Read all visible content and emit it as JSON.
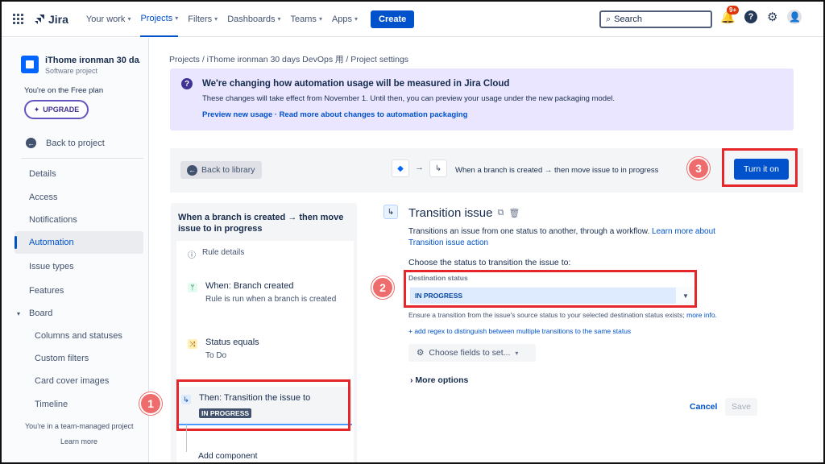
{
  "nav": {
    "logo": "Jira",
    "items": [
      "Your work",
      "Projects",
      "Filters",
      "Dashboards",
      "Teams",
      "Apps"
    ],
    "create": "Create",
    "search_placeholder": "Search",
    "notif_badge": "9+"
  },
  "sidebar": {
    "project_name": "iThome ironman 30 da...",
    "project_type": "Software project",
    "plan": "You're on the Free plan",
    "upgrade": "UPGRADE",
    "back": "Back to project",
    "items": [
      "Details",
      "Access",
      "Notifications",
      "Automation",
      "Issue types",
      "Features",
      "Board",
      "Columns and statuses",
      "Custom filters",
      "Card cover images",
      "Timeline"
    ],
    "team_note": "You're in a team-managed project",
    "learn_more": "Learn more"
  },
  "breadcrumb": "Projects  /  iThome ironman 30 days DevOps 用  /  Project settings",
  "banner": {
    "title": "We're changing how automation usage will be measured in Jira Cloud",
    "text": "These changes will take effect from November 1. Until then, you can preview your usage under the new packaging model.",
    "links": "Preview new usage · Read more about changes to automation packaging"
  },
  "rulebar": {
    "back_library": "Back to library",
    "summary": "When a branch is created → then move issue to in progress",
    "turn_on": "Turn it on"
  },
  "rule_panel": {
    "title": "When a branch is created → then move issue to in progress",
    "details": "Rule details",
    "steps": [
      {
        "title": "When: Branch created",
        "sub": "Rule is run when a branch is created"
      },
      {
        "title": "Status equals",
        "sub": "To Do"
      },
      {
        "title": "Then: Transition the issue to",
        "sub": "IN PROGRESS"
      }
    ],
    "add_component": "Add component"
  },
  "config": {
    "title": "Transition issue",
    "desc": "Transitions an issue from one status to another, through a workflow. ",
    "desc_link": "Learn more about Transition issue action",
    "choose": "Choose the status to transition the issue to:",
    "dest_label": "Destination status",
    "dest_value": "IN PROGRESS",
    "note": "Ensure a transition from the issue's source status to your selected destination status exists; ",
    "note_link": "more info.",
    "regex": "+ add regex to distinguish between multiple transitions to the same status",
    "fields": "Choose fields to set...",
    "more": "More options",
    "cancel": "Cancel",
    "save": "Save"
  },
  "callouts": [
    "1",
    "2",
    "3"
  ],
  "colors": {
    "primary": "#0052cc",
    "highlight": "#e5262b",
    "callout": "#ef6c6c",
    "banner": "#eae6ff"
  }
}
